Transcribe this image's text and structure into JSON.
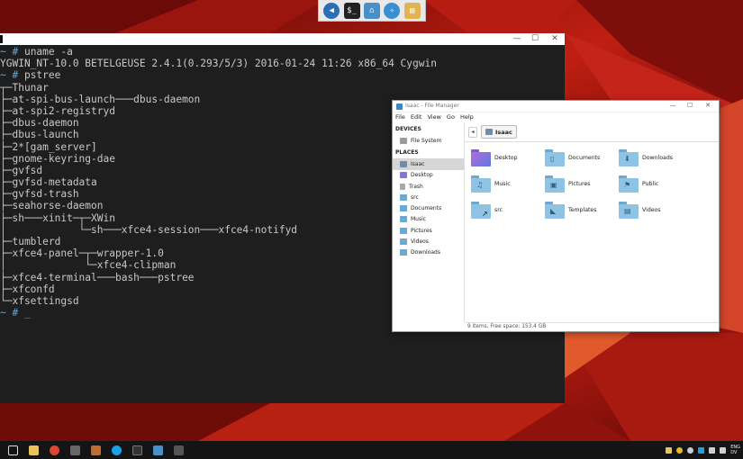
{
  "terminal": {
    "window_controls": {
      "minimize": "—",
      "maximize": "☐",
      "close": "✕"
    },
    "lines": [
      {
        "prompt": "~ # ",
        "text": "uname -a"
      },
      {
        "prompt": "",
        "text": "YGWIN_NT-10.0 BETELGEUSE 2.4.1(0.293/5/3) 2016-01-24 11:26 x86_64 Cygwin"
      },
      {
        "prompt": "~ # ",
        "text": "pstree"
      },
      {
        "prompt": "",
        "text": "┬─Thunar"
      },
      {
        "prompt": "",
        "text": "├─at-spi-bus-launch───dbus-daemon"
      },
      {
        "prompt": "",
        "text": "├─at-spi2-registryd"
      },
      {
        "prompt": "",
        "text": "├─dbus-daemon"
      },
      {
        "prompt": "",
        "text": "├─dbus-launch"
      },
      {
        "prompt": "",
        "text": "├─2*[gam_server]"
      },
      {
        "prompt": "",
        "text": "├─gnome-keyring-dae"
      },
      {
        "prompt": "",
        "text": "├─gvfsd"
      },
      {
        "prompt": "",
        "text": "├─gvfsd-metadata"
      },
      {
        "prompt": "",
        "text": "├─gvfsd-trash"
      },
      {
        "prompt": "",
        "text": "├─seahorse-daemon"
      },
      {
        "prompt": "",
        "text": "├─sh───xinit─┬─XWin"
      },
      {
        "prompt": "",
        "text": "│            └─sh───xfce4-session───xfce4-notifyd"
      },
      {
        "prompt": "",
        "text": "├─tumblerd"
      },
      {
        "prompt": "",
        "text": "├─xfce4-panel─┬─wrapper-1.0"
      },
      {
        "prompt": "",
        "text": "│             └─xfce4-clipman"
      },
      {
        "prompt": "",
        "text": "├─xfce4-terminal───bash───pstree"
      },
      {
        "prompt": "",
        "text": "├─xfconfd"
      },
      {
        "prompt": "",
        "text": "└─xfsettingsd"
      },
      {
        "prompt": "~ # ",
        "text": "_"
      }
    ]
  },
  "file_manager": {
    "title": "Isaac - File Manager",
    "window_controls": {
      "minimize": "—",
      "maximize": "☐",
      "close": "✕"
    },
    "menu": [
      "File",
      "Edit",
      "View",
      "Go",
      "Help"
    ],
    "sidebar": {
      "devices_heading": "DEVICES",
      "devices": [
        {
          "label": "File System",
          "icon": "drive-icon"
        }
      ],
      "places_heading": "PLACES",
      "places": [
        {
          "label": "Isaac",
          "icon": "home-icon"
        },
        {
          "label": "Desktop",
          "icon": "desktop-icon"
        },
        {
          "label": "Trash",
          "icon": "trash-icon"
        },
        {
          "label": "src",
          "icon": "folder-icon"
        },
        {
          "label": "Documents",
          "icon": "folder-icon"
        },
        {
          "label": "Music",
          "icon": "folder-icon"
        },
        {
          "label": "Pictures",
          "icon": "folder-icon"
        },
        {
          "label": "Videos",
          "icon": "folder-icon"
        },
        {
          "label": "Downloads",
          "icon": "folder-icon"
        }
      ]
    },
    "toolbar": {
      "back_label": "◂",
      "location": "Isaac"
    },
    "items": [
      {
        "label": "Desktop",
        "icon": "desktop-folder-icon",
        "glyph": ""
      },
      {
        "label": "Documents",
        "icon": "documents-folder-icon",
        "glyph": "▯"
      },
      {
        "label": "Downloads",
        "icon": "downloads-folder-icon",
        "glyph": "⬇"
      },
      {
        "label": "Music",
        "icon": "music-folder-icon",
        "glyph": "♫"
      },
      {
        "label": "Pictures",
        "icon": "pictures-folder-icon",
        "glyph": "▣"
      },
      {
        "label": "Public",
        "icon": "public-folder-icon",
        "glyph": "⚑"
      },
      {
        "label": "src",
        "icon": "src-folder-icon",
        "glyph": "↗"
      },
      {
        "label": "Templates",
        "icon": "templates-folder-icon",
        "glyph": "◣"
      },
      {
        "label": "Videos",
        "icon": "videos-folder-icon",
        "glyph": "▤"
      }
    ],
    "status": "9 items, Free space: 153.4 GB"
  },
  "tray": {
    "lang": "ENG",
    "region": "DV"
  },
  "colors": {
    "terminal_bg": "#1e1e1e",
    "prompt": "#5fa8d8",
    "folder": "#8fc3e4",
    "taskbar": "#141414"
  }
}
